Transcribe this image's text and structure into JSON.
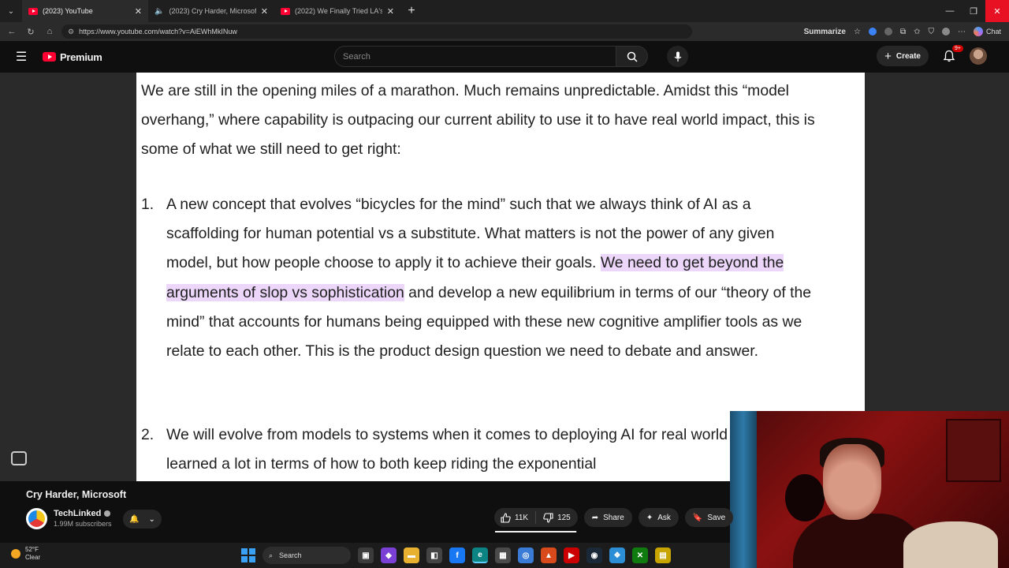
{
  "browser": {
    "tabs": [
      {
        "title": "(2023) YouTube",
        "active": true
      },
      {
        "title": "(2023) Cry Harder, Microsoft",
        "active": false,
        "audio": true
      },
      {
        "title": "(2022) We Finally Tried LA's Most",
        "active": false
      }
    ],
    "url": "https://www.youtube.com/watch?v=AiEWhMkINuw",
    "summarize_label": "Summarize",
    "chat_label": "Chat"
  },
  "youtube": {
    "logo_text": "Premium",
    "search_placeholder": "Search",
    "create_label": "Create",
    "notification_badge": "9+"
  },
  "video_frame": {
    "intro": "We are still in the opening miles of a marathon. Much remains unpredictable. Amidst this “model overhang,” where capability is outpacing our current ability to use it to have real world impact, this is some of what we still need to get right:",
    "items": [
      {
        "num": "1.",
        "text_before": "A new concept that evolves “bicycles for the mind” such that we always think of AI as a scaffolding for human potential vs a substitute. What matters is not the power of any given model, but how people choose to apply it to achieve their goals. ",
        "highlight": "We need to get beyond the arguments of slop vs sophistication",
        "text_after": " and develop a new equilibrium in terms of our “theory of the mind” that accounts for humans being equipped with these new cognitive amplifier tools as we relate to each other. This is the product design question we need to debate and answer."
      },
      {
        "num": "2.",
        "text_before": "We will evolve from models to systems when it comes to deploying AI for real world impact. We have learned a lot in terms of how to both keep riding the exponential",
        "highlight": "",
        "text_after": ""
      }
    ]
  },
  "video_info": {
    "title": "Cry Harder, Microsoft",
    "channel_name": "TechLinked",
    "subscribers": "1.99M subscribers",
    "likes": "11K",
    "dislikes": "125",
    "like_ratio": 0.99,
    "share_label": "Share",
    "ask_label": "Ask",
    "save_label": "Save"
  },
  "taskbar": {
    "temperature": "52°F",
    "condition": "Clear",
    "search_label": "Search"
  }
}
